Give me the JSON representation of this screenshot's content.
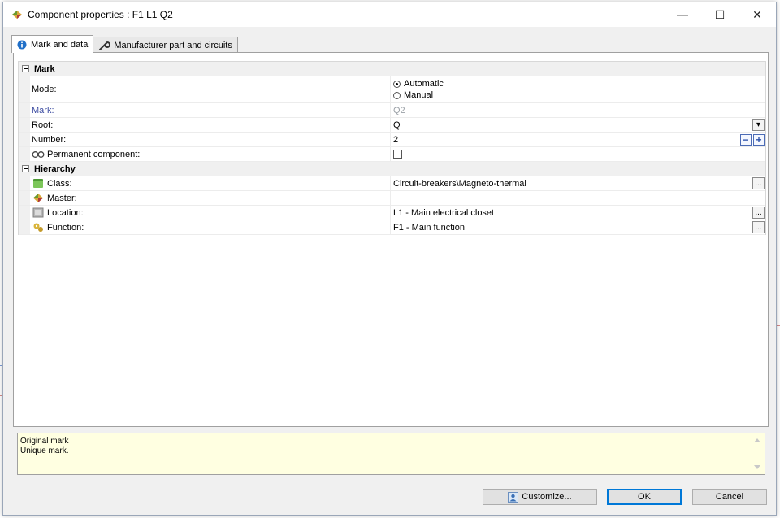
{
  "window": {
    "title": "Component properties : F1 L1 Q2",
    "minimize_glyph": "—",
    "maximize_glyph": "☐",
    "close_glyph": "✕"
  },
  "tabs": [
    {
      "label": "Mark and data",
      "icon": "info-icon",
      "active": true
    },
    {
      "label": "Manufacturer part and circuits",
      "icon": "wrench-icon",
      "active": false
    }
  ],
  "sections": {
    "mark": {
      "title": "Mark",
      "mode_label": "Mode:",
      "mode_options": [
        "Automatic",
        "Manual"
      ],
      "mode_selected": "Automatic",
      "mark_label": "Mark:",
      "mark_value": "Q2",
      "root_label": "Root:",
      "root_value": "Q",
      "number_label": "Number:",
      "number_value": "2",
      "permanent_label": "Permanent component:",
      "permanent_checked": false
    },
    "hierarchy": {
      "title": "Hierarchy",
      "class_label": "Class:",
      "class_value": "Circuit-breakers\\Magneto-thermal",
      "master_label": "Master:",
      "master_value": "",
      "location_label": "Location:",
      "location_value": "L1 - Main electrical closet",
      "function_label": "Function:",
      "function_value": "F1 - Main function"
    }
  },
  "controls": {
    "browse_glyph": "...",
    "dropdown_glyph": "▾",
    "minus_glyph": "−",
    "plus_glyph": "+"
  },
  "description": {
    "title": "Original mark",
    "text": "Unique mark."
  },
  "buttons": {
    "customize": "Customize...",
    "ok": "OK",
    "cancel": "Cancel"
  },
  "colors": {
    "accent": "#0078d7",
    "description_bg": "#ffffe1"
  }
}
